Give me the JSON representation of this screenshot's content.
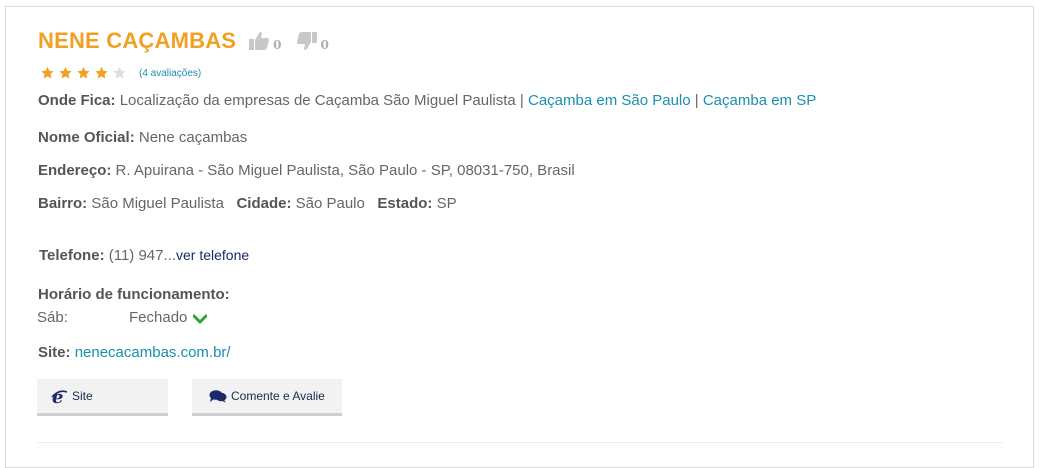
{
  "listing": {
    "title": "NENE CAÇAMBAS",
    "likes": "0",
    "dislikes": "0",
    "rating": 4,
    "rating_max": 5,
    "reviews_text": "(4 avaliações)",
    "colors": {
      "title": "#f0a022",
      "star_on": "#f0a022",
      "star_off": "#dddddd",
      "link": "#1a8fb0",
      "check": "#2ea52e"
    }
  },
  "location": {
    "label": "Onde Fica:",
    "text": "Localização da empresas de Caçamba São Miguel Paulista",
    "sep1": "|",
    "link1": "Caçamba em São Paulo",
    "sep2": "|",
    "link2": "Caçamba em SP"
  },
  "official_name": {
    "label": "Nome Oficial:",
    "value": "Nene caçambas"
  },
  "address": {
    "label": "Endereço:",
    "value": "R. Apuirana - São Miguel Paulista, São Paulo - SP, 08031-750, Brasil"
  },
  "area": {
    "bairro_label": "Bairro:",
    "bairro": "São Miguel Paulista",
    "cidade_label": "Cidade:",
    "cidade": "São Paulo",
    "estado_label": "Estado:",
    "estado": "SP"
  },
  "phone": {
    "label": "Telefone:",
    "value": "(11) 947...",
    "reveal": "ver telefone"
  },
  "hours": {
    "label": "Horário de funcionamento:",
    "day": "Sáb:",
    "status": "Fechado"
  },
  "site": {
    "label": "Site:",
    "url": "nenecacambas.com.br/"
  },
  "buttons": {
    "site": "Site",
    "comment": "Comente e Avalie"
  },
  "icons": [
    "thumbs-up-icon",
    "thumbs-down-icon",
    "star-icon",
    "chevron-down-icon",
    "internet-explorer-icon",
    "comments-icon"
  ]
}
